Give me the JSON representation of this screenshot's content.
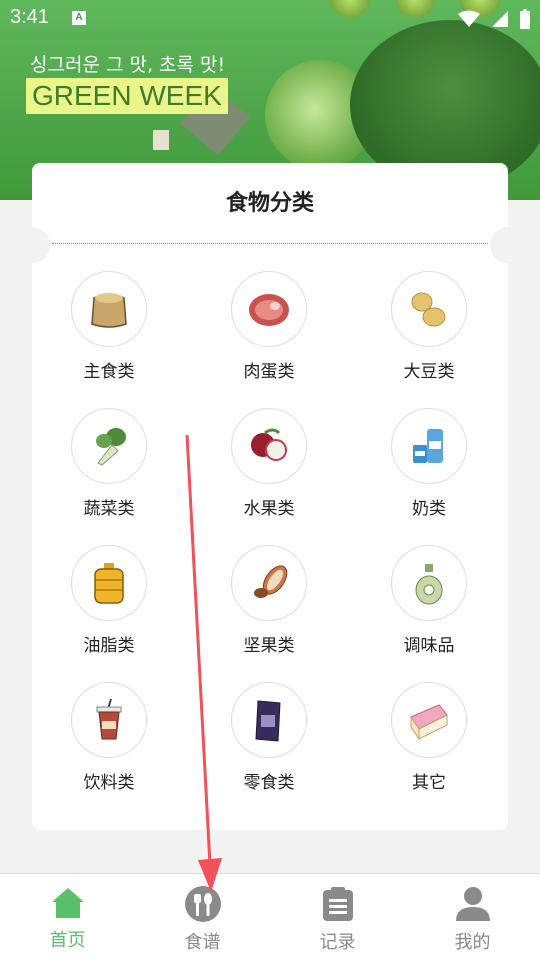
{
  "status_bar": {
    "time": "3:41",
    "notification": "A"
  },
  "banner": {
    "korean_text": "싱그러운 그 맛, 초록 맛!",
    "headline": "GREEN WEEK"
  },
  "card": {
    "title": "食物分类"
  },
  "categories": [
    {
      "label": "主食类",
      "icon": "grain-sack-icon"
    },
    {
      "label": "肉蛋类",
      "icon": "meat-icon"
    },
    {
      "label": "大豆类",
      "icon": "soybean-icon"
    },
    {
      "label": "蔬菜类",
      "icon": "bok-choy-icon"
    },
    {
      "label": "水果类",
      "icon": "lychee-icon"
    },
    {
      "label": "奶类",
      "icon": "milk-icon"
    },
    {
      "label": "油脂类",
      "icon": "oil-jug-icon"
    },
    {
      "label": "坚果类",
      "icon": "nut-icon"
    },
    {
      "label": "调味品",
      "icon": "seasoning-bottle-icon"
    },
    {
      "label": "饮料类",
      "icon": "drink-cup-icon"
    },
    {
      "label": "零食类",
      "icon": "snack-bag-icon"
    },
    {
      "label": "其它",
      "icon": "cake-icon"
    }
  ],
  "nav": [
    {
      "label": "首页",
      "icon": "home-icon",
      "active": true
    },
    {
      "label": "食谱",
      "icon": "utensils-icon",
      "active": false
    },
    {
      "label": "记录",
      "icon": "clipboard-icon",
      "active": false
    },
    {
      "label": "我的",
      "icon": "user-icon",
      "active": false
    }
  ],
  "colors": {
    "accent": "#58c16a",
    "inactive": "#8a8a8a",
    "arrow": "#f0525a"
  }
}
